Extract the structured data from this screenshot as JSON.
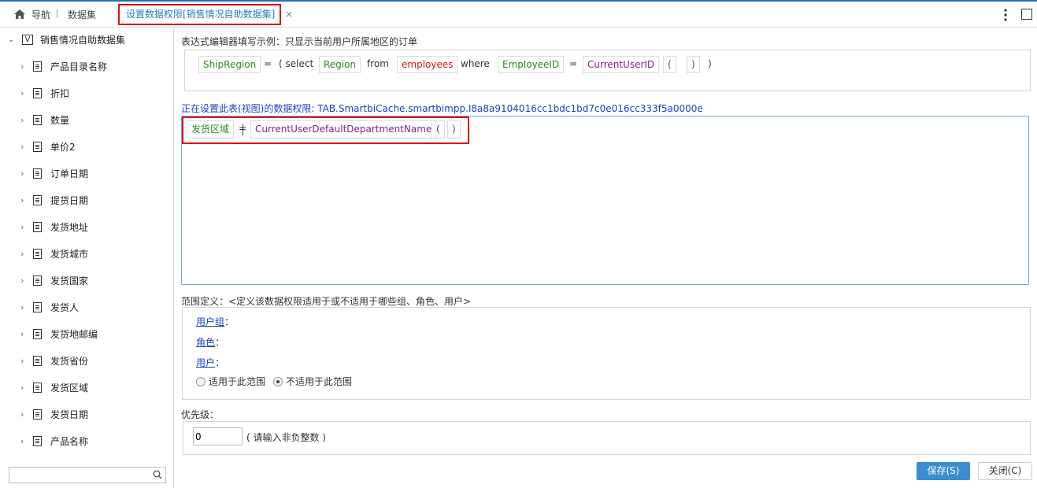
{
  "topbar": {
    "home_label": "导航",
    "dataset_label": "数据集",
    "active_tab": "设置数据权限[销售情况自助数据集]",
    "close_glyph": "×"
  },
  "sidebar": {
    "root": {
      "expander": "⌄",
      "type_glyph": "V",
      "label": "销售情况自助数据集"
    },
    "items": [
      "产品目录名称",
      "折扣",
      "数量",
      "单价2",
      "订单日期",
      "提货日期",
      "发货地址",
      "发货城市",
      "发货国家",
      "发货人",
      "发货地邮编",
      "发货省份",
      "发货区域",
      "发货日期",
      "产品名称"
    ],
    "search_placeholder": ""
  },
  "main": {
    "hint_label": "表达式编辑器填写示例：只显示当前用户所属地区的订单",
    "example_tokens": [
      {
        "text": "ShipRegion",
        "kind": "field"
      },
      {
        "text": "=",
        "kind": "plain"
      },
      {
        "text": "( select",
        "kind": "plain"
      },
      {
        "text": "Region",
        "kind": "field"
      },
      {
        "text": "from",
        "kind": "plain"
      },
      {
        "text": "employees",
        "kind": "table"
      },
      {
        "text": "where",
        "kind": "plain"
      },
      {
        "text": "EmployeeID",
        "kind": "field"
      },
      {
        "text": "=",
        "kind": "plain"
      },
      {
        "text": "CurrentUserID",
        "kind": "func"
      },
      {
        "text": "(",
        "kind": "paren"
      },
      {
        "text": ")",
        "kind": "paren"
      },
      {
        "text": ")",
        "kind": "plain"
      }
    ],
    "setting_label": "正在设置此表(视图)的数据权限: TAB.SmartbiCache.smartbimpp.I8a8a9104016cc1bdc1bd7c0e016cc333f5a0000e",
    "editor_tokens": [
      {
        "text": "发货区域",
        "kind": "field"
      },
      {
        "text": "=",
        "kind": "plain"
      },
      {
        "text": "CurrentUserDefaultDepartmentName",
        "kind": "func"
      },
      {
        "text": "(",
        "kind": "func"
      },
      {
        "text": ")",
        "kind": "func"
      }
    ],
    "scope_label": "范围定义：<定义该数据权限适用于或不适用于哪些组、角色、用户>",
    "scope": {
      "group_link": "用户组",
      "group_suffix": "：",
      "role_link": "角色",
      "role_suffix": "：",
      "user_link": "用户",
      "user_suffix": "：",
      "radio_apply": "适用于此范围",
      "radio_not_apply": "不适用于此范围",
      "selected": "not_apply"
    },
    "priority_label": "优先级：",
    "priority_value": "0",
    "priority_hint": "( 请输入非负整数 )",
    "save_button": "保存(S)",
    "close_button": "关闭(C)"
  },
  "colors": {
    "accent": "#3a8ed0",
    "highlight_border": "#d9141b",
    "field_text": "#2d8a1e",
    "table_text": "#d9141b",
    "func_text": "#8a1e8a",
    "link_text": "#1a3fc4"
  }
}
